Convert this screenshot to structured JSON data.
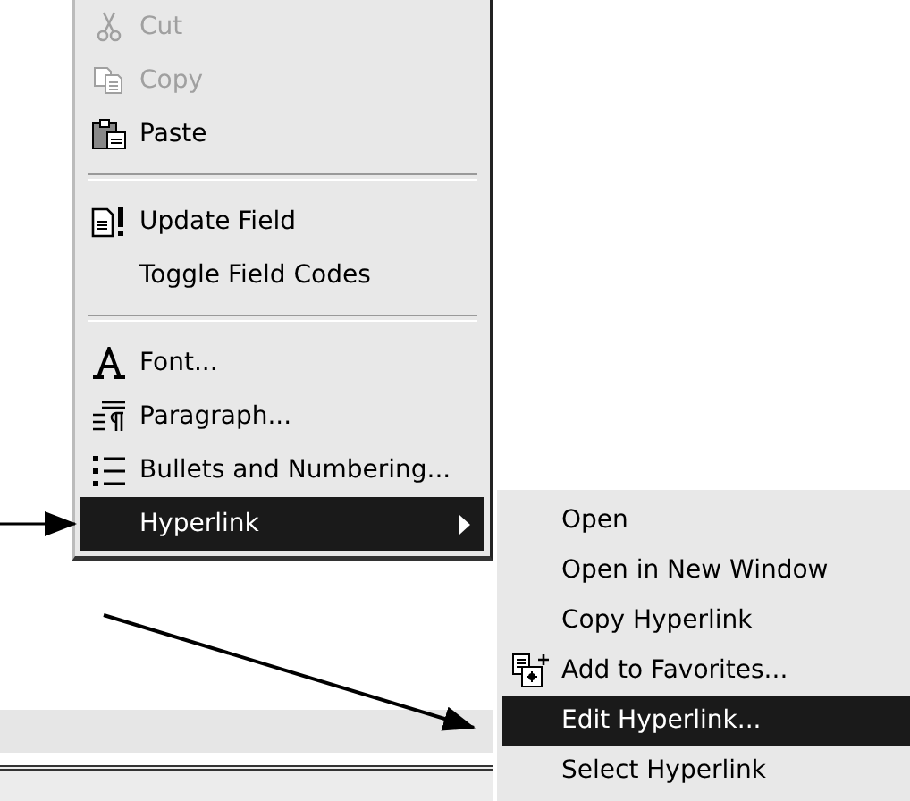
{
  "context_menu": {
    "items": [
      {
        "kind": "item",
        "label": "Cut",
        "disabled": true,
        "selected": false,
        "has_submenu": false
      },
      {
        "kind": "item",
        "label": "Copy",
        "disabled": true,
        "selected": false,
        "has_submenu": false
      },
      {
        "kind": "item",
        "label": "Paste",
        "disabled": false,
        "selected": false,
        "has_submenu": false
      },
      {
        "kind": "separator"
      },
      {
        "kind": "item",
        "label": "Update Field",
        "disabled": false,
        "selected": false,
        "has_submenu": false
      },
      {
        "kind": "item",
        "label": "Toggle Field Codes",
        "disabled": false,
        "selected": false,
        "has_submenu": false
      },
      {
        "kind": "separator"
      },
      {
        "kind": "item",
        "label": "Font...",
        "disabled": false,
        "selected": false,
        "has_submenu": false
      },
      {
        "kind": "item",
        "label": "Paragraph...",
        "disabled": false,
        "selected": false,
        "has_submenu": false
      },
      {
        "kind": "item",
        "label": "Bullets and Numbering...",
        "disabled": false,
        "selected": false,
        "has_submenu": false
      },
      {
        "kind": "item",
        "label": "Hyperlink",
        "disabled": false,
        "selected": true,
        "has_submenu": true
      }
    ]
  },
  "submenu": {
    "items": [
      {
        "kind": "item",
        "label": "Open",
        "selected": false
      },
      {
        "kind": "item",
        "label": "Open in New Window",
        "selected": false
      },
      {
        "kind": "item",
        "label": "Copy Hyperlink",
        "selected": false
      },
      {
        "kind": "item",
        "label": "Add to Favorites...",
        "selected": false
      },
      {
        "kind": "item",
        "label": "Edit Hyperlink...",
        "selected": true
      },
      {
        "kind": "item",
        "label": "Select Hyperlink",
        "selected": false
      }
    ]
  }
}
